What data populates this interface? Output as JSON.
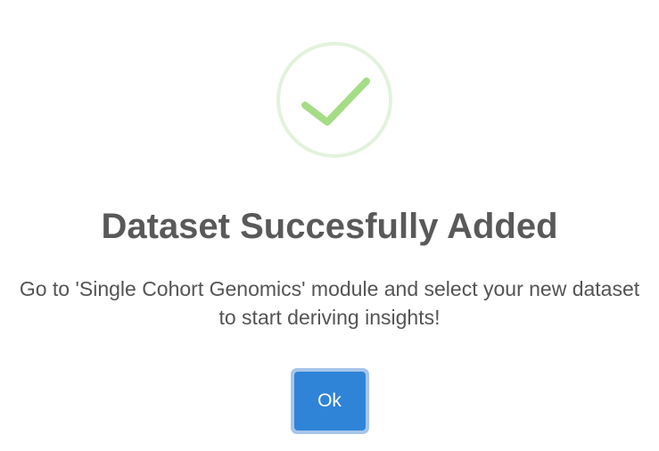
{
  "dialog": {
    "icon": "success-check-icon",
    "title": "Dataset Succesfully Added",
    "message": "Go to 'Single Cohort Genomics' module and select your new dataset to start deriving insights!",
    "ok_label": "Ok"
  },
  "colors": {
    "success_ring": "#e3f2dc",
    "success_check": "#a5dc86",
    "title_text": "#595959",
    "message_text": "#545454",
    "button_bg": "#2f84d7",
    "button_focus_ring": "#a7c5ea",
    "button_text": "#ffffff"
  }
}
